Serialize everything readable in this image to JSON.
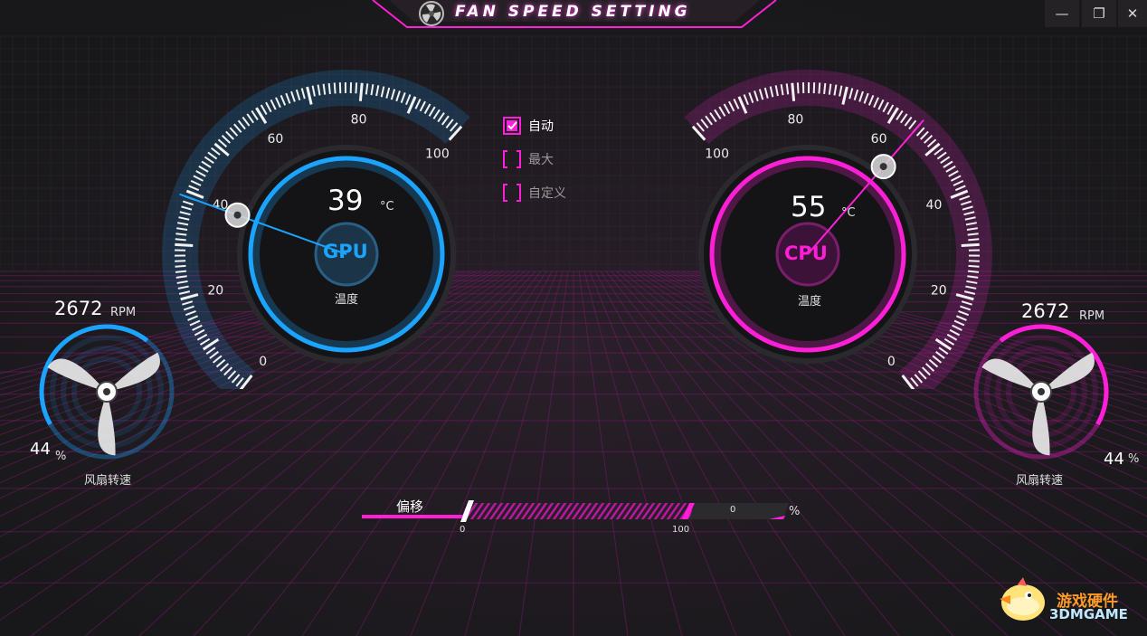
{
  "window": {
    "title": "FAN SPEED SETTING",
    "controls": {
      "minimize": "—",
      "restore": "❐",
      "close": "✕"
    }
  },
  "gpu": {
    "temperature": "39",
    "temp_unit": "°C",
    "badge": "GPU",
    "temp_label": "温度",
    "gauge_ticks": [
      "0",
      "20",
      "40",
      "60",
      "80",
      "100"
    ],
    "gauge_value": 39,
    "fan_rpm": "2672",
    "rpm_unit": "RPM",
    "fan_percent": "44",
    "percent_unit": "%",
    "fan_level": 44,
    "fan_label": "风扇转速",
    "accent_color": "#1aa3ff"
  },
  "cpu": {
    "temperature": "55",
    "temp_unit": "°C",
    "badge": "CPU",
    "temp_label": "温度",
    "gauge_ticks": [
      "0",
      "20",
      "40",
      "60",
      "80",
      "100"
    ],
    "gauge_value": 55,
    "fan_rpm": "2672",
    "rpm_unit": "RPM",
    "fan_percent": "44",
    "percent_unit": "%",
    "fan_level": 44,
    "fan_label": "风扇转速",
    "accent_color": "#ff1fd6"
  },
  "modes": [
    {
      "label": "自动",
      "checked": true
    },
    {
      "label": "最大",
      "checked": false
    },
    {
      "label": "自定义",
      "checked": false
    }
  ],
  "offset": {
    "label": "偏移",
    "min_label": "0",
    "max_label": "100",
    "value": "0",
    "unit": "%"
  },
  "watermark": {
    "cn": "游戏硬件",
    "en": "3DMGAME"
  }
}
